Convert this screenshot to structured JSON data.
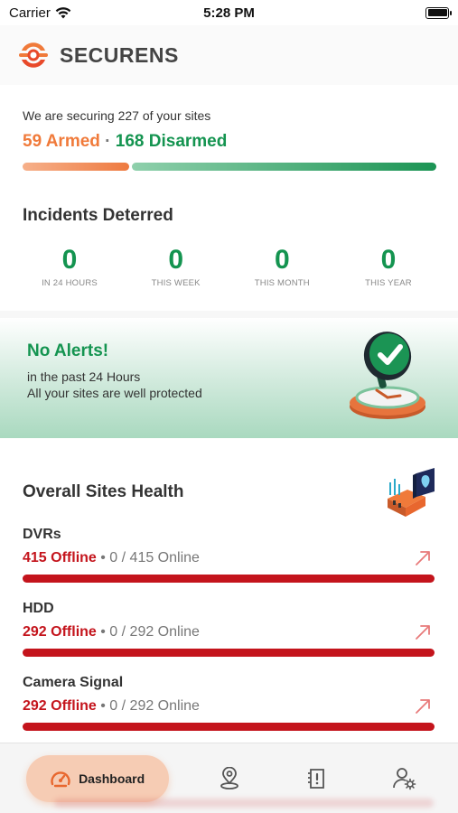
{
  "status_bar": {
    "carrier": "Carrier",
    "time": "5:28 PM"
  },
  "header": {
    "brand": "SECURENS"
  },
  "securing": {
    "text": "We are securing 227 of your sites",
    "armed": "59 Armed",
    "separator": " · ",
    "disarmed": "168 Disarmed",
    "armed_count": 59,
    "disarmed_count": 168,
    "colors": {
      "armed": "#f07a3a",
      "disarmed": "#149450"
    }
  },
  "incidents": {
    "title": "Incidents Deterred",
    "items": [
      {
        "value": "0",
        "label": "IN 24 HOURS"
      },
      {
        "value": "0",
        "label": "THIS WEEK"
      },
      {
        "value": "0",
        "label": "THIS MONTH"
      },
      {
        "value": "0",
        "label": "THIS YEAR"
      }
    ]
  },
  "alert": {
    "title": "No Alerts!",
    "subtitle": "in the past 24 Hours",
    "message": "All your sites are well protected",
    "icon": "shield-check-icon"
  },
  "health": {
    "title": "Overall Sites Health",
    "items": [
      {
        "title": "DVRs",
        "offline": "415 Offline",
        "online": " • 0 / 415 Online",
        "online_fraction": 0
      },
      {
        "title": "HDD",
        "offline": "292 Offline",
        "online": " • 0 / 292 Online",
        "online_fraction": 0
      },
      {
        "title": "Camera Signal",
        "offline": "292 Offline",
        "online": " • 0 / 292 Online",
        "online_fraction": 0
      }
    ],
    "colors": {
      "offline": "#c4141c"
    }
  },
  "nav": {
    "active_label": "Dashboard",
    "items": [
      "dashboard-icon",
      "location-pin-icon",
      "alert-log-icon",
      "user-settings-icon"
    ]
  }
}
